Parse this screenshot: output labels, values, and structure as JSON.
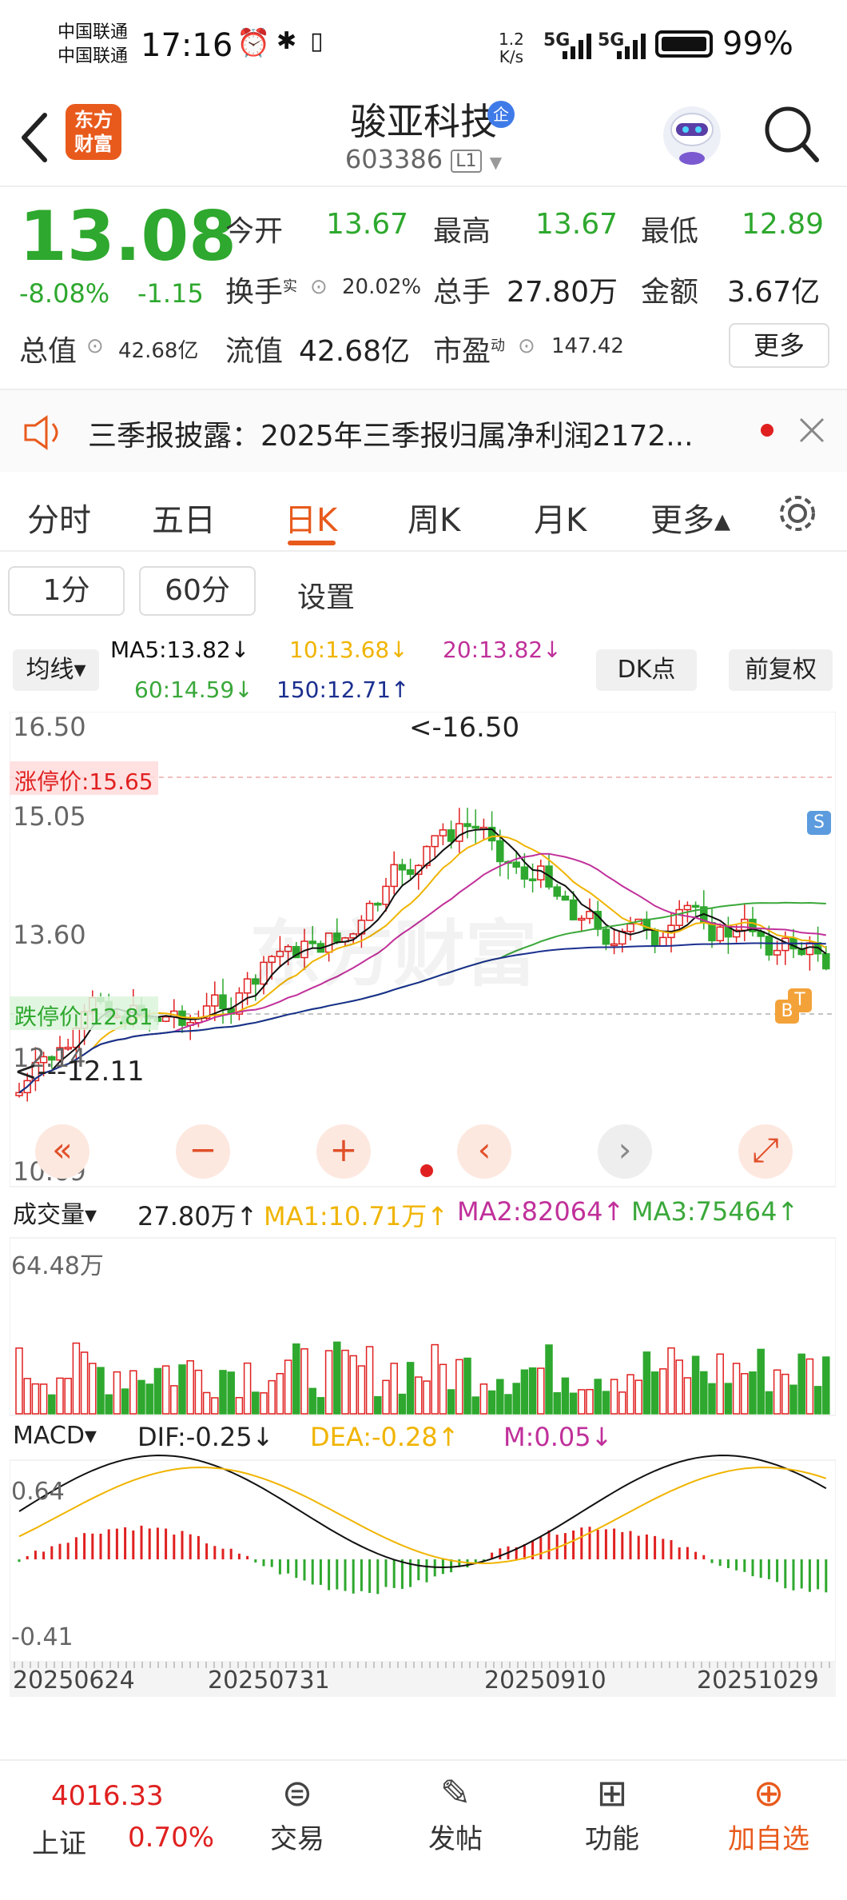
{
  "status_bar": {
    "carrier_1": "中国联通",
    "carrier_2": "中国联通",
    "time": "17:16",
    "net_speed_value": "1.2",
    "net_speed_unit": "K/s",
    "signal_1": "5G",
    "signal_2": "5G",
    "battery": "99%"
  },
  "header": {
    "back_icon": "back-arrow-icon",
    "brand_line1": "东方",
    "brand_line2": "财富",
    "title": "骏亚科技",
    "badge": "企",
    "code": "603386",
    "level": "L1",
    "avatar_icon": "robot-avatar-icon",
    "search_icon": "search-icon"
  },
  "quote": {
    "price": "13.08",
    "change_pct": "-8.08%",
    "change": "-1.15",
    "rows": [
      {
        "label": "今开",
        "value": "13.67",
        "color": "#16a016"
      },
      {
        "label": "最高",
        "value": "13.67",
        "color": "#16a016"
      },
      {
        "label": "最低",
        "value": "12.89",
        "color": "#16a016"
      }
    ],
    "row2": [
      {
        "label": "换手",
        "sup": "实",
        "value": "20.02%"
      },
      {
        "label": "总手",
        "value": "27.80万"
      },
      {
        "label": "金额",
        "value": "3.67亿"
      }
    ],
    "row3": [
      {
        "label": "总值",
        "value": "42.68亿"
      },
      {
        "label": "流值",
        "value": "42.68亿"
      },
      {
        "label": "市盈",
        "sup": "动",
        "value": "147.42"
      }
    ],
    "more_label": "更多"
  },
  "notice": {
    "text": "三季报披露：2025年三季报归属净利润2172..."
  },
  "period_tabs": [
    "分时",
    "五日",
    "日K",
    "周K",
    "月K",
    "更多▴"
  ],
  "active_tab": "日K",
  "sub_options": {
    "opt1": "1分",
    "opt2": "60分",
    "opt3": "设置"
  },
  "ma_legend": {
    "selector": "均线▾",
    "ma5": "MA5:13.82↓",
    "ma10": "10:13.68↓",
    "ma20": "20:13.82↓",
    "ma60": "60:14.59↓",
    "ma150": "150:12.71↑",
    "dk": "DK点",
    "adjust": "前复权"
  },
  "colors": {
    "up": "#e02020",
    "down": "#2ea82e",
    "ma5": "#111111",
    "ma10": "#f0b400",
    "ma20": "#c0309a",
    "ma60": "#3aa83a",
    "ma150": "#1b2f8f",
    "brand": "#e85a1c"
  },
  "kline": {
    "y_labels": [
      "16.50",
      "15.05",
      "13.60",
      "12.14",
      "10.69"
    ],
    "limit_up": "涨停价:15.65",
    "limit_down": "跌停价:12.81",
    "max_marker": "<-16.50",
    "min_marker": "<---12.11",
    "watermark": "东方财富",
    "signal_s": "S",
    "signal_b": "B",
    "signal_t": "T"
  },
  "volume": {
    "selector": "成交量▾",
    "value": "27.80万↑",
    "ma1": "MA1:10.71万↑",
    "ma2": "MA2:82064↑",
    "ma3": "MA3:75464↑",
    "max_label": "64.48万"
  },
  "macd": {
    "selector": "MACD▾",
    "dif": "DIF:-0.25↓",
    "dea": "DEA:-0.28↑",
    "m": "M:0.05↓",
    "top_label": "0.64",
    "bottom_label": "-0.41"
  },
  "dates": [
    "20250624",
    "20250731",
    "20250910",
    "20251029"
  ],
  "chart_controls": [
    "«",
    "−",
    "+",
    "‹",
    "›",
    "⤢"
  ],
  "bottom_bar": {
    "index_value": "4016.33",
    "index_name": "上证",
    "index_change": "0.70%",
    "trade": "交易",
    "post": "发帖",
    "func": "功能",
    "add": "加自选"
  }
}
